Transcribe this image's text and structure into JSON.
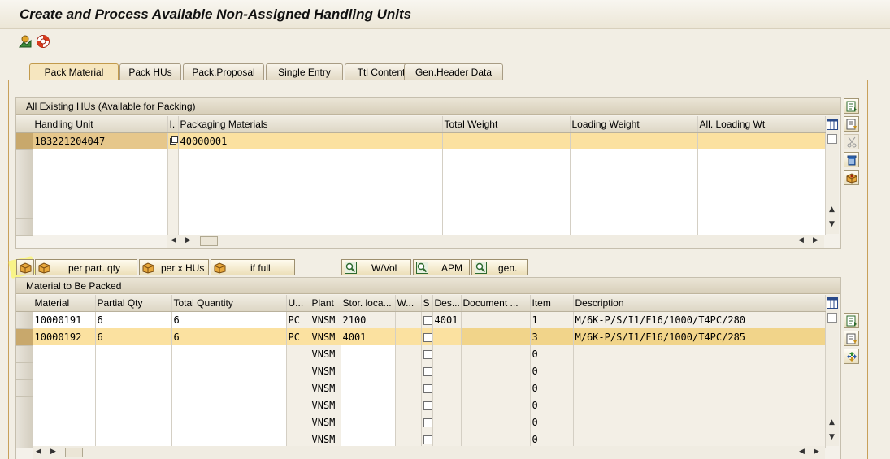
{
  "window": {
    "title": "Create and Process Available Non-Assigned Handling Units"
  },
  "toolbar": {
    "icons": [
      "display-overview-icon",
      "help-lifebuoy-icon"
    ]
  },
  "tabs": [
    {
      "label": "Pack Material",
      "active": true
    },
    {
      "label": "Pack HUs",
      "active": false
    },
    {
      "label": "Pack.Proposal",
      "active": false
    },
    {
      "label": "Single Entry",
      "active": false
    },
    {
      "label": "Ttl Content",
      "active": false
    },
    {
      "label": "Gen.Header Data",
      "active": false
    }
  ],
  "hu_panel": {
    "title": "All Existing HUs (Available for Packing)",
    "columns": [
      "Handling Unit",
      "I.",
      "Packaging Materials",
      "Total Weight",
      "Loading Weight",
      "All. Loading Wt"
    ],
    "rows": [
      {
        "handling_unit": "183221204047",
        "packaging_material": "40000001"
      }
    ]
  },
  "action_buttons": [
    {
      "label": "",
      "icon": "pack-icon"
    },
    {
      "label": "per part. qty",
      "icon": "pack-icon"
    },
    {
      "label": "per x HUs",
      "icon": "pack-icon"
    },
    {
      "label": "if full",
      "icon": "pack-icon"
    },
    {
      "label": "W/Vol",
      "icon": "search-icon"
    },
    {
      "label": "APM",
      "icon": "search-icon"
    },
    {
      "label": "gen.",
      "icon": "search-icon"
    }
  ],
  "material_panel": {
    "title": "Material to Be Packed",
    "columns": [
      "Material",
      "Partial Qty",
      "Total Quantity",
      "U...",
      "Plant",
      "Stor. loca...",
      "W...",
      "S",
      "Des...",
      "Document ...",
      "Item",
      "Description"
    ],
    "rows": [
      {
        "material": "10000191",
        "partial_qty": "6",
        "total_qty": "6",
        "unit": "PC",
        "plant": "VNSM",
        "stor_loc": "2100",
        "des": "4001",
        "item": "1",
        "description": "M/6K-P/S/I1/F16/1000/T4PC/280"
      },
      {
        "material": "10000192",
        "partial_qty": "6",
        "total_qty": "6",
        "unit": "PC",
        "plant": "VNSM",
        "stor_loc": "4001",
        "des": "",
        "item": "3",
        "description": "M/6K-P/S/I1/F16/1000/T4PC/285"
      },
      {
        "material": "",
        "partial_qty": "",
        "total_qty": "",
        "unit": "",
        "plant": "VNSM",
        "stor_loc": "",
        "des": "",
        "item": "0",
        "description": ""
      },
      {
        "material": "",
        "partial_qty": "",
        "total_qty": "",
        "unit": "",
        "plant": "VNSM",
        "stor_loc": "",
        "des": "",
        "item": "0",
        "description": ""
      },
      {
        "material": "",
        "partial_qty": "",
        "total_qty": "",
        "unit": "",
        "plant": "VNSM",
        "stor_loc": "",
        "des": "",
        "item": "0",
        "description": ""
      },
      {
        "material": "",
        "partial_qty": "",
        "total_qty": "",
        "unit": "",
        "plant": "VNSM",
        "stor_loc": "",
        "des": "",
        "item": "0",
        "description": ""
      },
      {
        "material": "",
        "partial_qty": "",
        "total_qty": "",
        "unit": "",
        "plant": "VNSM",
        "stor_loc": "",
        "des": "",
        "item": "0",
        "description": ""
      },
      {
        "material": "",
        "partial_qty": "",
        "total_qty": "",
        "unit": "",
        "plant": "VNSM",
        "stor_loc": "",
        "des": "",
        "item": "0",
        "description": ""
      }
    ]
  },
  "colors": {
    "highlight_row": "#fbe1a0",
    "tab_active": "#f6e6bf",
    "border_accent": "#c8a05a"
  }
}
